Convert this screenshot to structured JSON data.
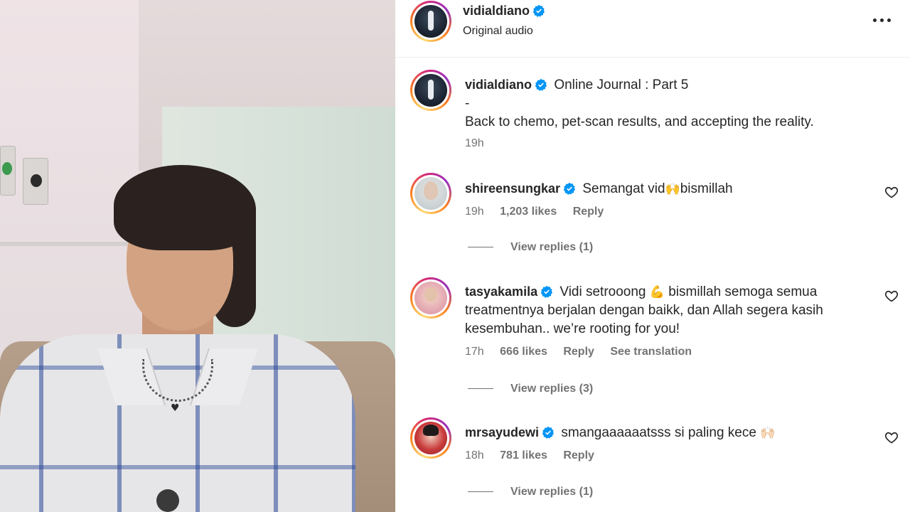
{
  "post": {
    "author": "vidialdiano",
    "audio": "Original audio"
  },
  "caption": {
    "author": "vidialdiano",
    "title": "Online Journal : Part 5",
    "dash": "-",
    "body": "Back to chemo, pet-scan results, and accepting the reality.",
    "time": "19h"
  },
  "comments": [
    {
      "username": "shireensungkar",
      "text_before": "Semangat vid",
      "emoji": "🙌",
      "text_after": "bismillah",
      "time": "19h",
      "likes": "1,203 likes",
      "reply": "Reply",
      "view_replies": "View replies (1)"
    },
    {
      "username": "tasyakamila",
      "line1_before": "Vidi setrooong",
      "emoji": "💪",
      "line1_after": "bismillah semoga semua",
      "line2": "treatmentnya berjalan dengan baikk, dan Allah segera kasih",
      "line3": "kesembuhan.. we’re rooting for you!",
      "time": "17h",
      "likes": "666 likes",
      "reply": "Reply",
      "see_translation": "See translation",
      "view_replies": "View replies (3)"
    },
    {
      "username": "mrsayudewi",
      "text_before": "smangaaaaaatsss si paling kece",
      "emoji": "🙌🏻",
      "time": "18h",
      "likes": "781 likes",
      "reply": "Reply",
      "view_replies": "View replies (1)"
    }
  ],
  "icons": {
    "verified": "verified-badge-icon",
    "more": "more-options-icon",
    "like": "heart-icon"
  },
  "colors": {
    "verified": "#0095f6",
    "text": "#262626",
    "secondary": "#737373"
  }
}
